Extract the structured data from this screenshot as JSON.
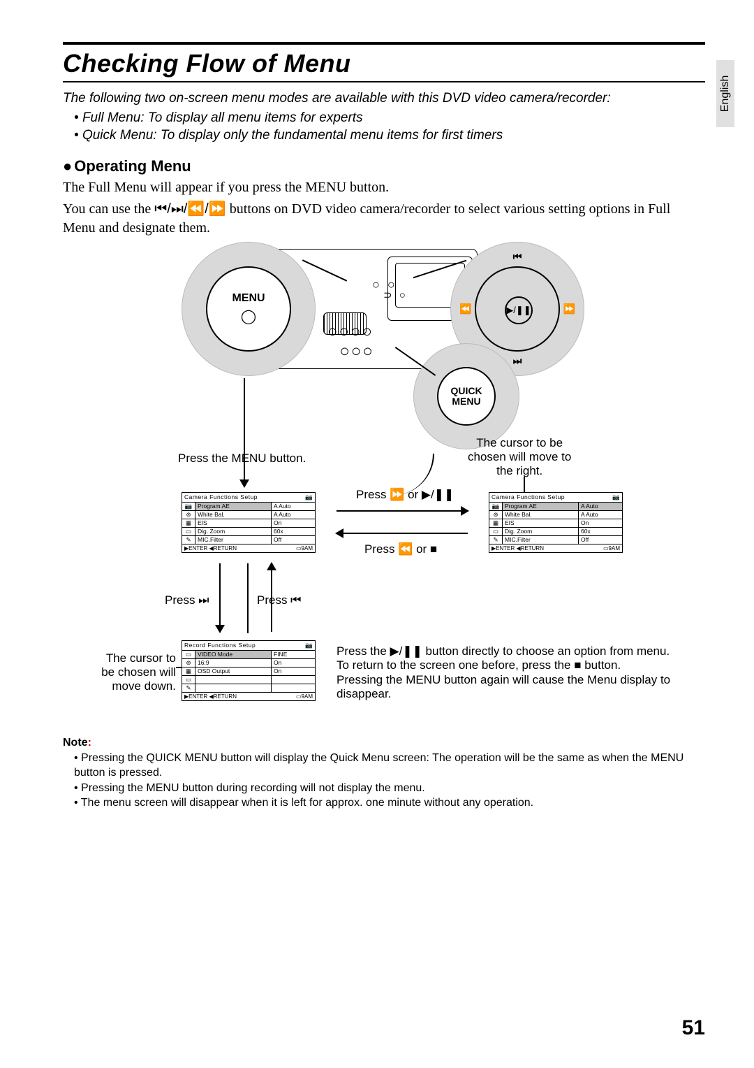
{
  "language_tab": "English",
  "page_number": "51",
  "title": "Checking Flow of Menu",
  "intro": {
    "desc": "The following two on-screen menu modes are available with this DVD video camera/recorder:",
    "bullets": [
      "Full Menu: To display all menu items for experts",
      "Quick Menu: To display only the fundamental menu items for first timers"
    ]
  },
  "section": {
    "heading": "Operating Menu",
    "p1": "The Full Menu will appear if you press the MENU button.",
    "p2a": "You can use the ",
    "p2_symbols": "⏮/⏭/⏪/⏩",
    "p2b": " buttons on DVD video camera/recorder to select various setting options in Full Menu and designate them."
  },
  "controls": {
    "menu": "MENU",
    "quick": "QUICK\nMENU",
    "dir_center": "▶/❚❚"
  },
  "flow": {
    "pressMenu": "Press the MENU button.",
    "cursorRight": "The cursor to be\nchosen will move to\nthe right.",
    "pressFwd": "Press ⏩ or ▶/❚❚",
    "pressRew": "Press ⏪ or ■",
    "pressNext": "Press ⏭",
    "pressPrev": "Press ⏮",
    "cursorDown": "The cursor to\nbe chosen will\nmove down.",
    "rightPara": "Press the ▶/❚❚ button directly to choose an option from menu.\nTo return to the screen one before, press the ■ button.\nPressing the MENU button again will cause the Menu display to disappear."
  },
  "osd_camera": {
    "title": "Camera Functions Setup",
    "rows": [
      {
        "icon": "📷",
        "name": "Program AE",
        "value": "A Auto",
        "selected": true
      },
      {
        "icon": "⊛",
        "name": "White Bal.",
        "value": "A Auto",
        "selected": false
      },
      {
        "icon": "▦",
        "name": "EIS",
        "value": "On",
        "selected": false
      },
      {
        "icon": "▭",
        "name": "Dig. Zoom",
        "value": "60x",
        "selected": false
      },
      {
        "icon": "✎",
        "name": "MIC.Filter",
        "value": "Off",
        "selected": false
      }
    ],
    "footer_left": "▶ENTER  ◀RETURN",
    "footer_right": "▭9AM"
  },
  "osd_record": {
    "title": "Record Functions Setup",
    "rows": [
      {
        "icon": "▭",
        "name": "VIDEO Mode",
        "value": "FINE",
        "selected": true
      },
      {
        "icon": "⊛",
        "name": "16:9",
        "value": "On",
        "selected": false
      },
      {
        "icon": "▦",
        "name": "OSD Output",
        "value": "On",
        "selected": false
      },
      {
        "icon": "▭",
        "name": "",
        "value": "",
        "selected": false
      },
      {
        "icon": "✎",
        "name": "",
        "value": "",
        "selected": false
      }
    ],
    "footer_left": "▶ENTER  ◀RETURN",
    "footer_right": "▭9AM"
  },
  "note": {
    "heading": "Note",
    "items": [
      "Pressing the QUICK MENU button will display the Quick Menu screen: The operation will be the same as when the MENU button is pressed.",
      "Pressing the MENU button during recording will not display the menu.",
      "The menu screen will disappear when it is left for approx. one minute without any operation."
    ]
  }
}
